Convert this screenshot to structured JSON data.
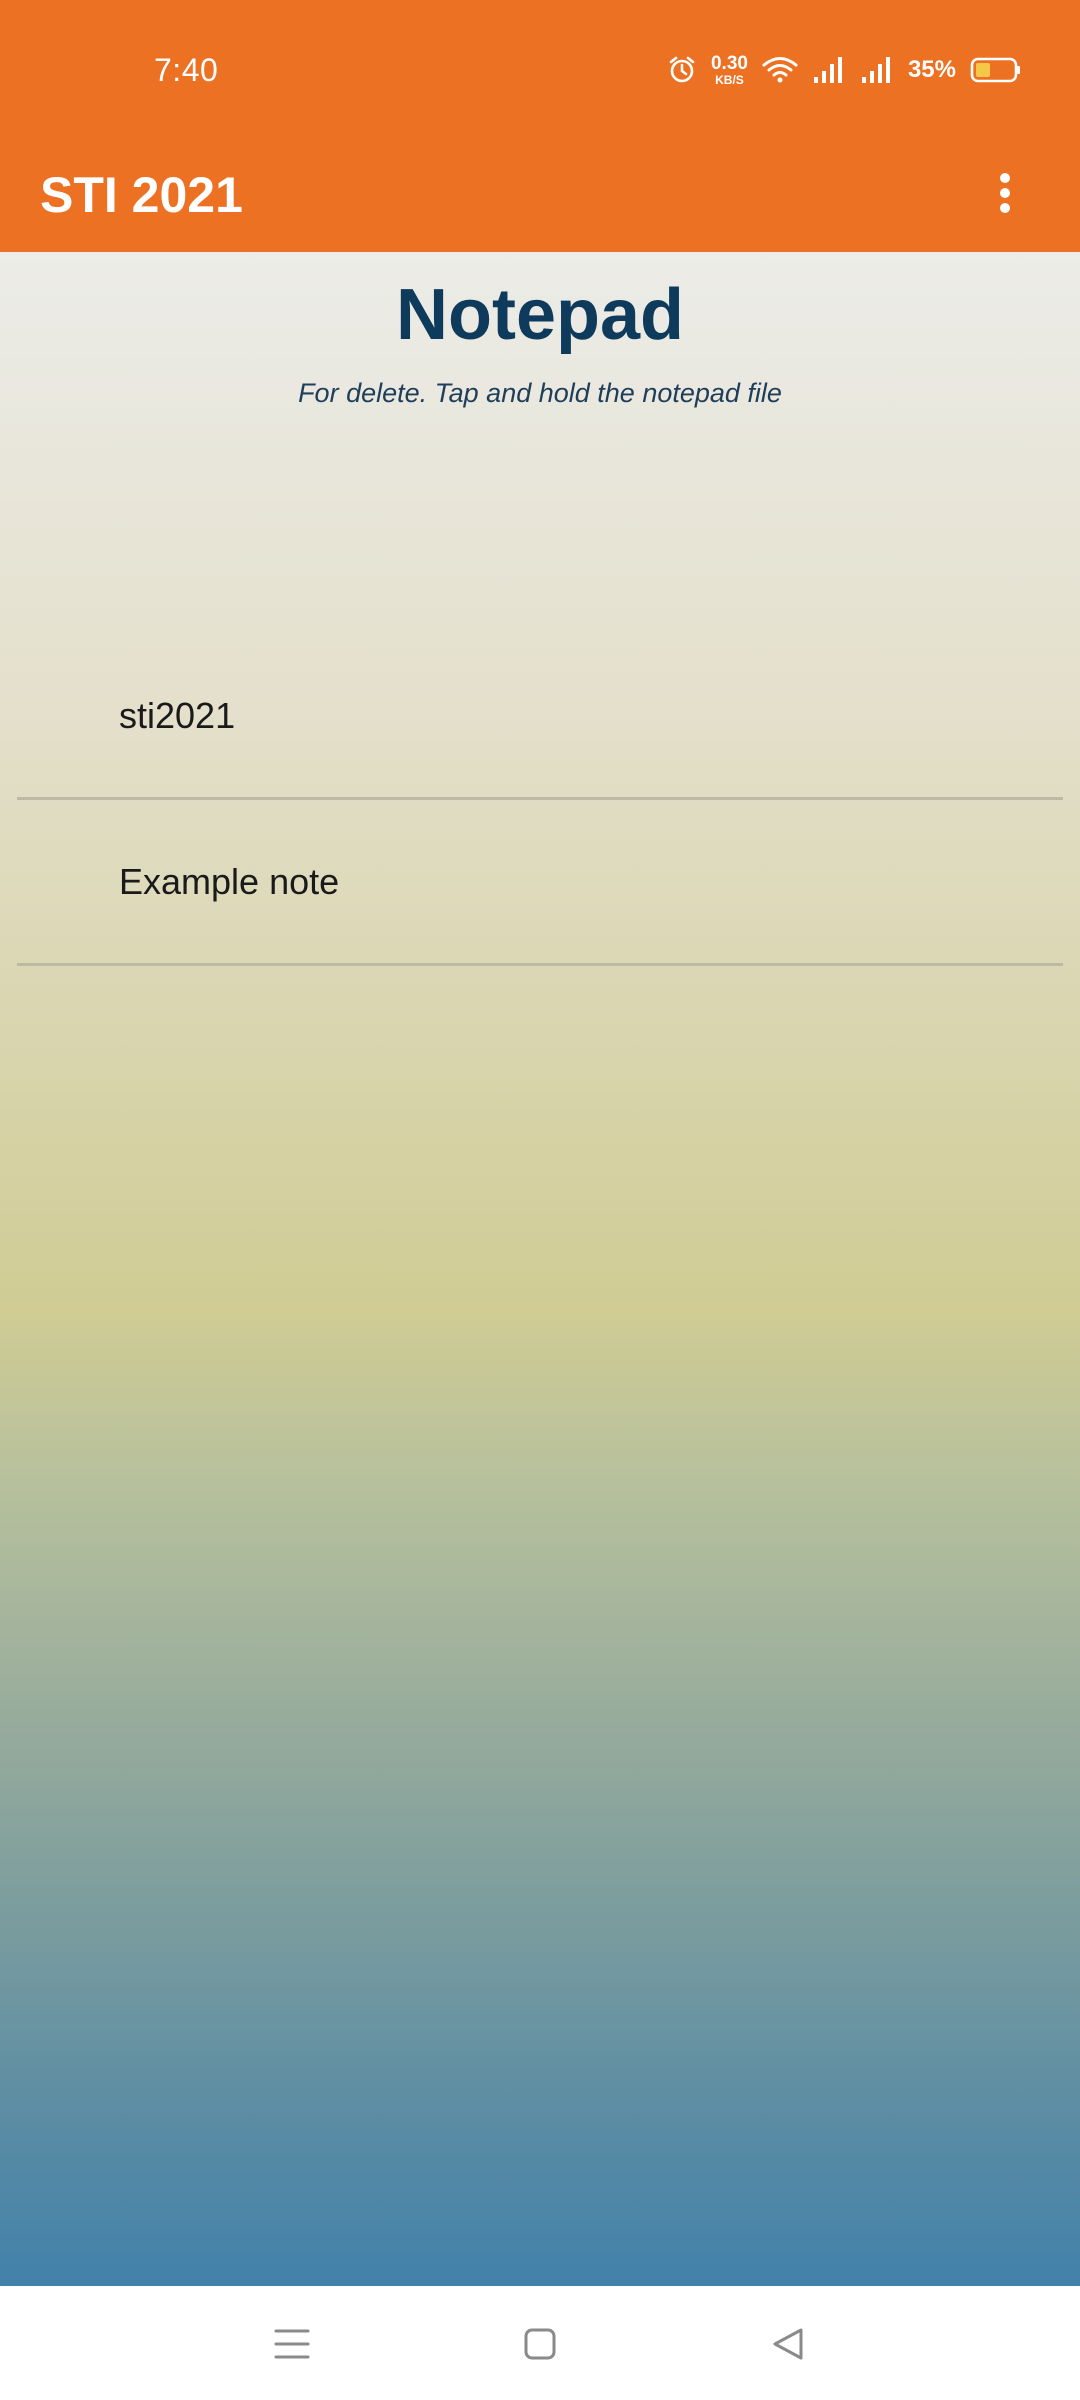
{
  "status_bar": {
    "time": "7:40",
    "net_speed_value": "0.30",
    "net_speed_unit": "KB/S",
    "battery_percent": "35%",
    "icons": [
      "alarm-icon",
      "wifi-icon",
      "signal-icon",
      "signal-icon",
      "battery-icon"
    ]
  },
  "app_bar": {
    "title": "STI 2021",
    "menu_icon": "more-vert-icon"
  },
  "main": {
    "title": "Notepad",
    "hint": "For delete. Tap and hold the notepad file",
    "notes": [
      {
        "label": "sti2021"
      },
      {
        "label": "Example note"
      }
    ]
  },
  "nav_bar": {
    "icons": [
      "recents-icon",
      "home-icon",
      "back-icon"
    ]
  },
  "colors": {
    "accent": "#EC7122",
    "title": "#0E3A5C",
    "gradient_top": "#ECECE8",
    "gradient_mid": "#D0CC94",
    "gradient_bottom": "#4281AA"
  }
}
